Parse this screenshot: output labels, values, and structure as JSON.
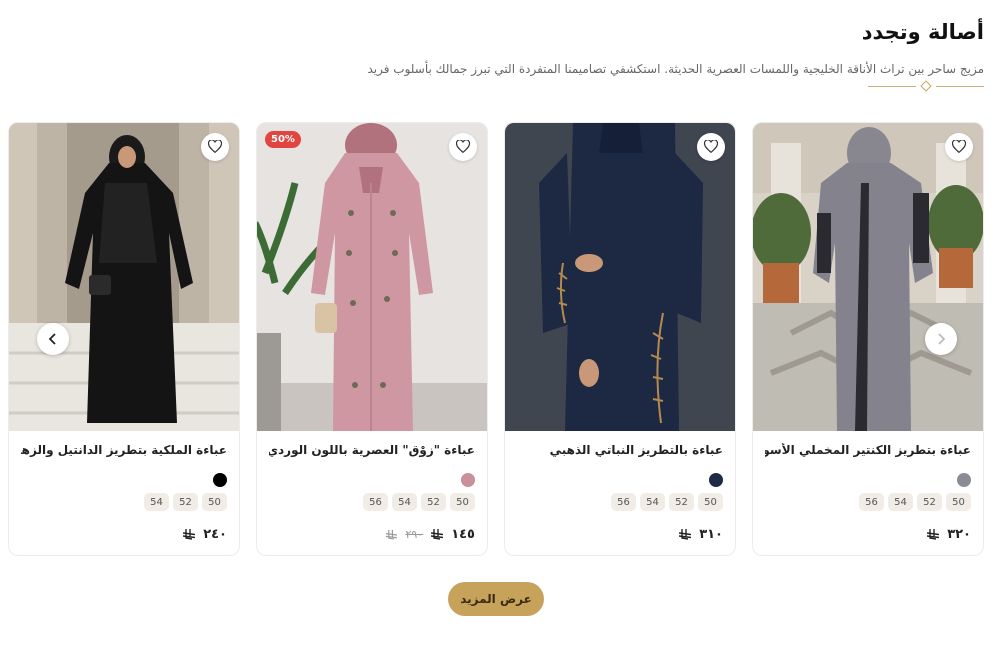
{
  "section": {
    "title": "أصالة وتجدد",
    "subtitle": "مزيج ساحر بين تراث الأناقة الخليجية واللمسات العصرية الحديثة. استكشفي تصاميمنا المتفردة التي تبرز جمالك بأسلوب فريد"
  },
  "products": [
    {
      "name": "عباءة بتطريز الكنتير المخملي الأسود",
      "swatch_color": "#8b8b95",
      "sizes": [
        "50",
        "52",
        "54",
        "56"
      ],
      "price": "٣٢٠",
      "currency_icon": "riyal-icon"
    },
    {
      "name": "عباءة بالتطريز النباتي الذهبي",
      "swatch_color": "#1f2a44",
      "sizes": [
        "50",
        "52",
        "54",
        "56"
      ],
      "price": "٣١٠",
      "currency_icon": "riyal-icon"
    },
    {
      "name": "عباءة \"زوْق\" العصرية باللون الوردي المطفي",
      "swatch_color": "#c98f9a",
      "sizes": [
        "50",
        "52",
        "54",
        "56"
      ],
      "price": "١٤٥",
      "old_price": "٢٩٠",
      "badge": "50%",
      "currency_icon": "riyal-icon"
    },
    {
      "name": "عباءة الملكية بتطريز الدانتيل والزهور البارزة",
      "swatch_color": "#000000",
      "sizes": [
        "50",
        "52",
        "54"
      ],
      "price": "٢٤٠",
      "currency_icon": "riyal-icon"
    }
  ],
  "more_button": {
    "label": "عرض المزيد"
  },
  "colors": {
    "accent": "#c7a25a",
    "badge": "#e0463f",
    "size_chip": "#f1ede6"
  }
}
